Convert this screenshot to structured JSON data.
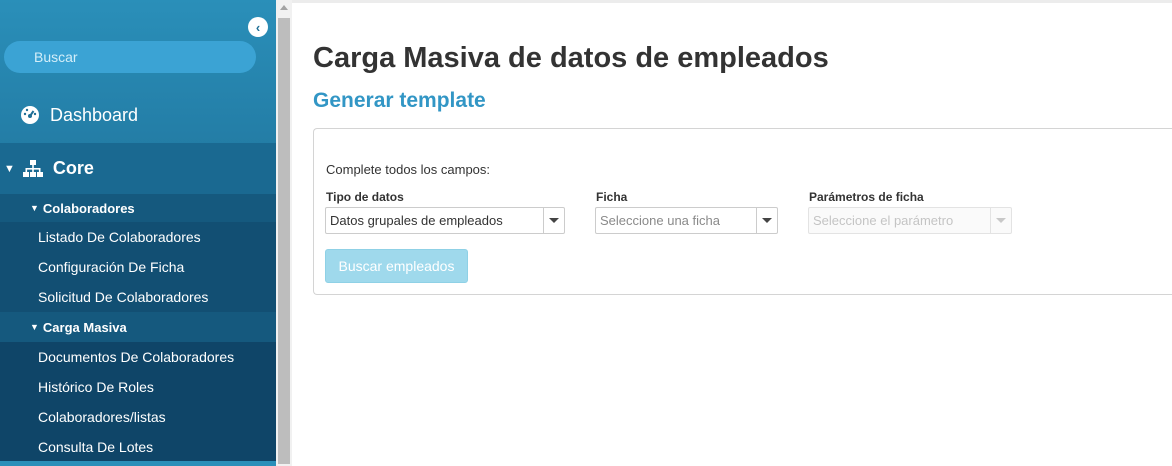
{
  "sidebar": {
    "collapse_icon": "chevron-left-icon",
    "search_placeholder": "Buscar",
    "dashboard": {
      "label": "Dashboard",
      "icon": "gauge-icon"
    },
    "core": {
      "label": "Core",
      "icon": "sitemap-icon",
      "expanded": true
    },
    "groups": [
      {
        "label": "Colaboradores",
        "expanded": true,
        "items": [
          "Listado De Colaboradores",
          "Configuración De Ficha",
          "Solicitud De Colaboradores"
        ]
      },
      {
        "label": "Carga Masiva",
        "expanded": true,
        "items": [
          "Documentos De Colaboradores",
          "Histórico De Roles",
          "Colaboradores/listas",
          "Consulta De Lotes"
        ]
      }
    ]
  },
  "main": {
    "title": "Carga Masiva de datos de empleados",
    "subtitle": "Generar template",
    "form": {
      "instructions": "Complete todos los campos:",
      "tipo_label": "Tipo de datos",
      "tipo_value": "Datos grupales de empleados",
      "ficha_label": "Ficha",
      "ficha_placeholder": "Seleccione una ficha",
      "param_label": "Parámetros de ficha",
      "param_placeholder": "Seleccione el parámetro",
      "submit_label": "Buscar empleados"
    }
  },
  "colors": {
    "sidebar": "#1e6f97",
    "accent": "#3296c5",
    "button_disabled": "#9fd9ec",
    "title": "#333333"
  }
}
